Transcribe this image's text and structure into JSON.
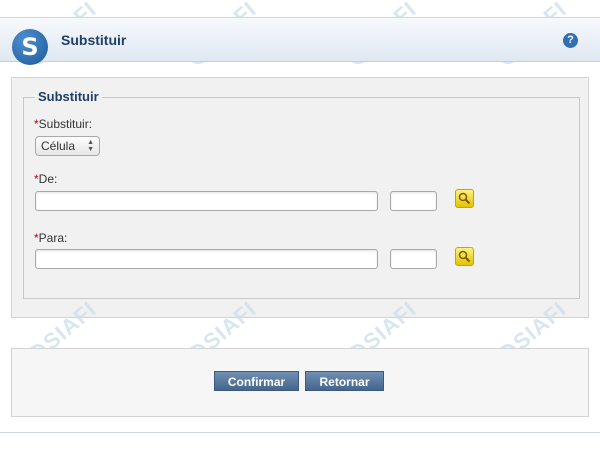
{
  "header": {
    "title": "Substituir",
    "logo_glyph": "S",
    "help_glyph": "?"
  },
  "watermark": {
    "text": "SIAFI"
  },
  "form": {
    "legend": "Substituir",
    "required_marker": "*",
    "substituir": {
      "label": "Substituir:",
      "selected": "Célula"
    },
    "de": {
      "label": "De:",
      "value": "",
      "value2": ""
    },
    "para": {
      "label": "Para:",
      "value": "",
      "value2": ""
    }
  },
  "actions": {
    "confirmar": "Confirmar",
    "retornar": "Retornar"
  },
  "colors": {
    "header_title": "#1f3f66",
    "required": "#cc0000",
    "button": "#44658d"
  }
}
